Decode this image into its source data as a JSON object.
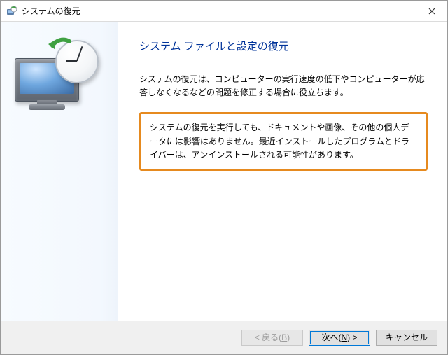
{
  "window": {
    "title": "システムの復元"
  },
  "content": {
    "heading": "システム ファイルと設定の復元",
    "intro": "システムの復元は、コンピューターの実行速度の低下やコンピューターが応答しなくなるなどの問題を修正する場合に役立ちます。",
    "highlight": "システムの復元を実行しても、ドキュメントや画像、その他の個人データには影響はありません。最近インストールしたプログラムとドライバーは、アンインストールされる可能性があります。"
  },
  "buttons": {
    "back_prefix": "< 戻る(",
    "back_key": "B",
    "back_suffix": ")",
    "next_prefix": "次へ(",
    "next_key": "N",
    "next_suffix": ") >",
    "cancel": "キャンセル"
  },
  "icons": {
    "app": "system-restore-icon",
    "close": "close-icon",
    "wizard": "restore-clock-icon"
  },
  "colors": {
    "heading": "#003399",
    "highlight_border": "#e68a1f",
    "default_button_border": "#0078d7"
  }
}
